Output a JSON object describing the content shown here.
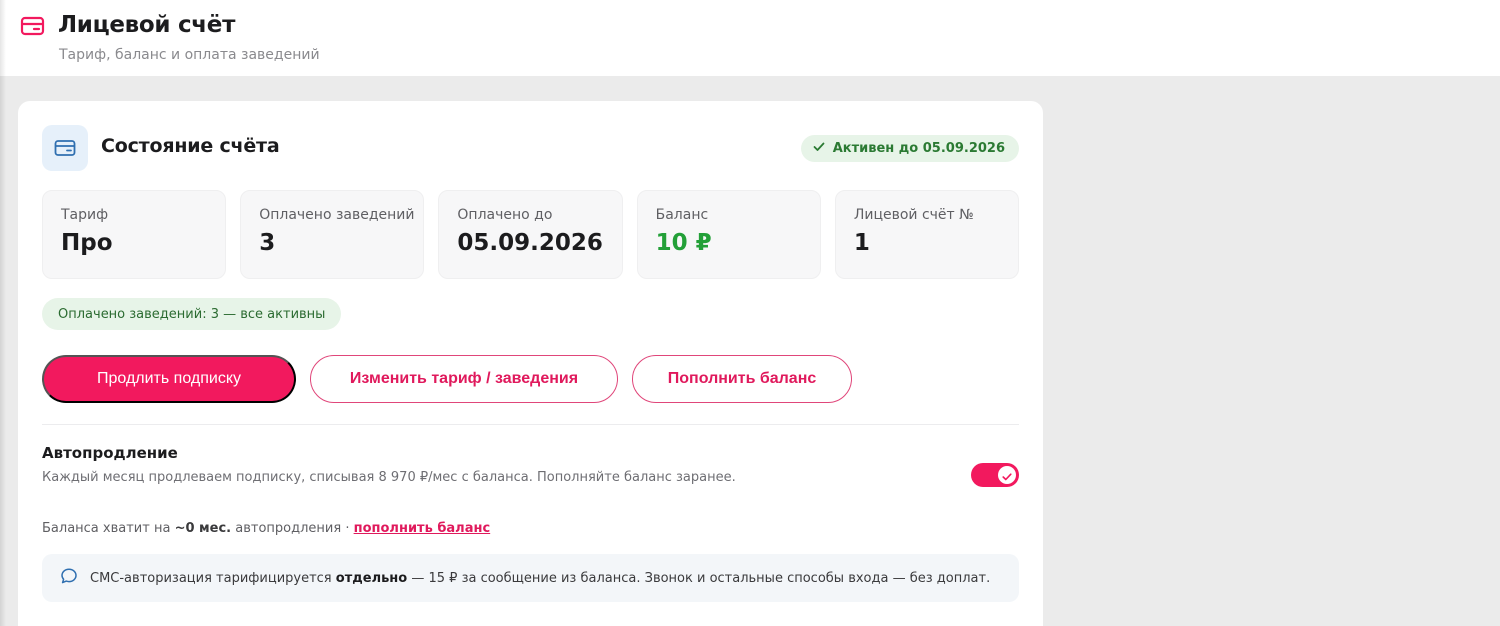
{
  "header": {
    "title": "Лицевой счёт",
    "subtitle": "Тариф, баланс и оплата заведений",
    "icon": "card-icon"
  },
  "account_card": {
    "title": "Состояние счёта",
    "icon": "wallet-icon",
    "status_badge": "Активен до 05.09.2026",
    "stats": [
      {
        "label": "Тариф",
        "value": "Про"
      },
      {
        "label": "Оплачено заведений",
        "value": "3"
      },
      {
        "label": "Оплачено до",
        "value": "05.09.2026"
      },
      {
        "label": "Баланс",
        "value": "10 ₽"
      },
      {
        "label": "Лицевой счёт №",
        "value": "1"
      }
    ],
    "venues_info": "Оплачено заведений: 3 — все активны",
    "buttons": {
      "extend": "Продлить подписку",
      "change_plan": "Изменить тариф / заведения",
      "top_up": "Пополнить баланс"
    },
    "autorenew": {
      "title": "Автопродление",
      "description": "Каждый месяц продлеваем подписку, списывая 8 970 ₽/мес с баланса. Пополняйте баланс заранее.",
      "enabled": true
    },
    "balance_runway": {
      "prefix": "Баланса хватит на",
      "months": "~0 мес.",
      "suffix": "автопродления ·",
      "link": "пополнить баланс"
    },
    "sms_note": {
      "prefix": "СМС-авторизация тарифицируется",
      "bold": "отдельно",
      "suffix": "— 15 ₽ за сообщение из баланса. Звонок и остальные способы входа — без доплат."
    }
  },
  "colors": {
    "accent": "#f2195e",
    "success_text": "#2b7a33",
    "success_bg": "#e7f4e8",
    "balance_green": "#23a038"
  }
}
